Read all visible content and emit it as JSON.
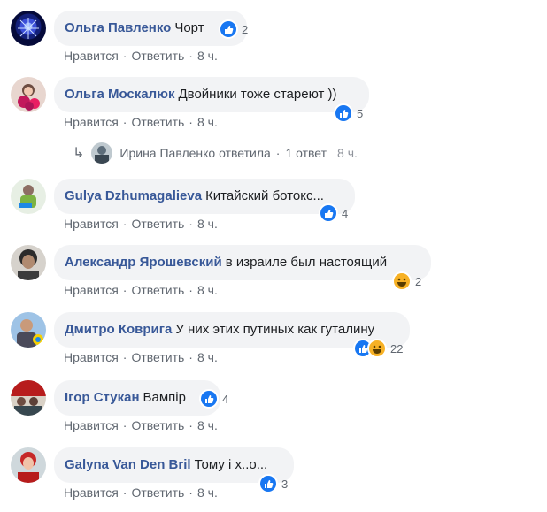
{
  "actions": {
    "like": "Нравится",
    "reply": "Ответить",
    "separator": "·"
  },
  "comments": [
    {
      "author": "Ольга Павленко",
      "text": "Чорт",
      "time": "8 ч.",
      "reaction_count": "2",
      "reactions": [
        "like-icon"
      ]
    },
    {
      "author": "Ольга Москалюк",
      "text": "Двойники тоже стареют ))",
      "time": "8 ч.",
      "reaction_count": "5",
      "reactions": [
        "like-icon"
      ]
    },
    {
      "author": "Gulya Dzhumagalieva",
      "text": "Китайский ботокс...",
      "time": "8 ч.",
      "reaction_count": "4",
      "reactions": [
        "like-icon"
      ]
    },
    {
      "author": "Александр Ярошевский",
      "text": "в израиле был настоящий",
      "time": "8 ч.",
      "reaction_count": "2",
      "reactions": [
        "haha-icon"
      ]
    },
    {
      "author": "Дмитро Коврига",
      "text": "У них этих путиных как гуталину",
      "time": "8 ч.",
      "reaction_count": "22",
      "reactions": [
        "like-icon",
        "haha-icon"
      ]
    },
    {
      "author": "Ігор Стукан",
      "text": "Вампір",
      "time": "8 ч.",
      "reaction_count": "4",
      "reactions": [
        "like-icon"
      ]
    },
    {
      "author": "Galyna Van Den Bril",
      "text": "Тому і х..о...",
      "time": "8 ч.",
      "reaction_count": "3",
      "reactions": [
        "like-icon"
      ]
    }
  ],
  "reply_summary": {
    "arrow_icon": "reply-arrow-icon",
    "text": "Ирина Павленко ответила",
    "count": "1 ответ",
    "time": "8 ч."
  },
  "colors": {
    "author": "#385898",
    "bubble": "#f2f3f5",
    "meta": "#606770",
    "like": "#1877f2",
    "haha": "#f7b125"
  }
}
